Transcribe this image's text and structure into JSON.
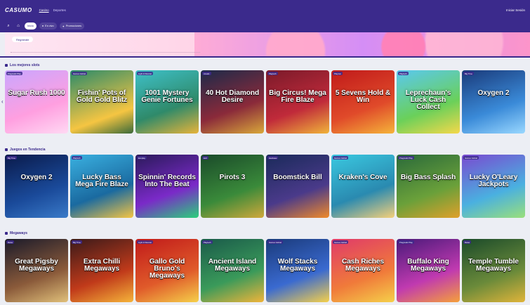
{
  "header": {
    "logo": "CASUMO",
    "nav": [
      {
        "label": "Casino",
        "active": true
      },
      {
        "label": "Deportes",
        "active": false
      }
    ],
    "right": "Iniciar Sesión"
  },
  "subnav": {
    "items": [
      {
        "label": "Inicio",
        "active": true
      },
      {
        "label": "En vivo",
        "active": false
      },
      {
        "label": "Promociones",
        "active": false
      }
    ]
  },
  "hero": {
    "button": "Regístrate"
  },
  "sections": [
    {
      "title": "Los mejores slots",
      "tiles": [
        {
          "title": "Sugar Rush 1000",
          "badge": "Pragmatic Play",
          "bg": "linear-gradient(160deg,#c9a6ff,#ff9fe0 60%,#ffd9f3)"
        },
        {
          "title": "Fishin' Pots of Gold Gold Blitz",
          "badge": "Games Global",
          "bg": "linear-gradient(160deg,#2a8a6a,#f5c542 70%,#3a6a3a)"
        },
        {
          "title": "1001 Mystery Genie Fortunes",
          "badge": "Light & Wonder",
          "bg": "linear-gradient(160deg,#3ec0c8,#2f8a6a 60%,#e7b33a)"
        },
        {
          "title": "40 Hot Diamond Desire",
          "badge": "Amatic",
          "bg": "linear-gradient(160deg,#1c2a4a,#8a2a3a 60%,#d9a83a)"
        },
        {
          "title": "Big Circus! Mega Fire Blaze",
          "badge": "Playtech",
          "bg": "linear-gradient(160deg,#7a1a2a,#c02a3a 60%,#f0b43a)"
        },
        {
          "title": "5 Sevens Hold & Win",
          "badge": "Playson",
          "bg": "linear-gradient(160deg,#c01a1a,#e04a2a 60%,#f5b43a)"
        },
        {
          "title": "Leprechaun's Luck Cash Collect",
          "badge": "Playtech",
          "bg": "linear-gradient(160deg,#5ac8f0,#6ad05a 60%,#f5d84a)"
        },
        {
          "title": "Oxygen 2",
          "badge": "Big Time",
          "bg": "linear-gradient(160deg,#1a3a7a,#3a8ad8 60%,#9ad8ff)"
        }
      ]
    },
    {
      "title": "Juegos en Tendencia",
      "tiles": [
        {
          "title": "Oxygen 2",
          "badge": "Big Time",
          "bg": "linear-gradient(160deg,#0a1a4a,#1a4a9a 60%,#3a7ac8)"
        },
        {
          "title": "Lucky Bass Mega Fire Blaze",
          "badge": "Playtech",
          "bg": "linear-gradient(160deg,#3ab0e0,#1a6aa0 60%,#f5c542)"
        },
        {
          "title": "Spinnin' Records Into The Beat",
          "badge": "Evoplay",
          "bg": "linear-gradient(160deg,#2a1a5a,#7a2ac8 60%,#2ad07a)"
        },
        {
          "title": "Pirots 3",
          "badge": "ELK",
          "bg": "linear-gradient(160deg,#1a4a2a,#3a8a3a 60%,#d0a83a)"
        },
        {
          "title": "Boomstick Bill",
          "badge": "Hacksaw",
          "bg": "linear-gradient(160deg,#1a2a5a,#4a3a8a 60%,#f08a2a)"
        },
        {
          "title": "Kraken's Cove",
          "badge": "Games Global",
          "bg": "linear-gradient(160deg,#3ac8e0,#2a8ab0 60%,#f5d07a)"
        },
        {
          "title": "Big Bass Splash",
          "badge": "Pragmatic Play",
          "bg": "linear-gradient(160deg,#2a6a3a,#6aa03a 60%,#e0a02a)"
        },
        {
          "title": "Lucky O'Leary Jackpots",
          "badge": "Games Global",
          "bg": "linear-gradient(160deg,#7a4ad0,#4ab0e0 60%,#9ae07a)"
        }
      ]
    },
    {
      "title": "Megaways",
      "tiles": [
        {
          "title": "Great Pigsby Megaways",
          "badge": "Relax",
          "bg": "linear-gradient(160deg,#1a1a2a,#8a5a3a 60%,#e0c07a)"
        },
        {
          "title": "Extra Chilli Megaways",
          "badge": "Big Time",
          "bg": "linear-gradient(160deg,#3a1a1a,#c03a1a 60%,#f5b43a)"
        },
        {
          "title": "Gallo Gold Bruno's Megaways",
          "badge": "Light & Wonder",
          "bg": "linear-gradient(160deg,#c01a1a,#e05a2a 60%,#f5d04a)"
        },
        {
          "title": "Ancient Island Megaways",
          "badge": "Playtech",
          "bg": "linear-gradient(160deg,#1a5a4a,#3a9a5a 60%,#f0b43a)"
        },
        {
          "title": "Wolf Stacks Megaways",
          "badge": "Games Global",
          "bg": "linear-gradient(160deg,#1a3a7a,#3a6ad0 60%,#f5d04a)"
        },
        {
          "title": "Cash Riches Megaways",
          "badge": "Games Global",
          "bg": "linear-gradient(160deg,#e03a6a,#f07a3a 60%,#f5d04a)"
        },
        {
          "title": "Buffalo King Megaways",
          "badge": "Pragmatic Play",
          "bg": "linear-gradient(160deg,#4a1a7a,#c03ab0 60%,#f5a03a)"
        },
        {
          "title": "Temple Tumble Megaways",
          "badge": "Relax",
          "bg": "linear-gradient(160deg,#1a4a2a,#6a8a3a 60%,#e0b43a)"
        }
      ]
    }
  ]
}
